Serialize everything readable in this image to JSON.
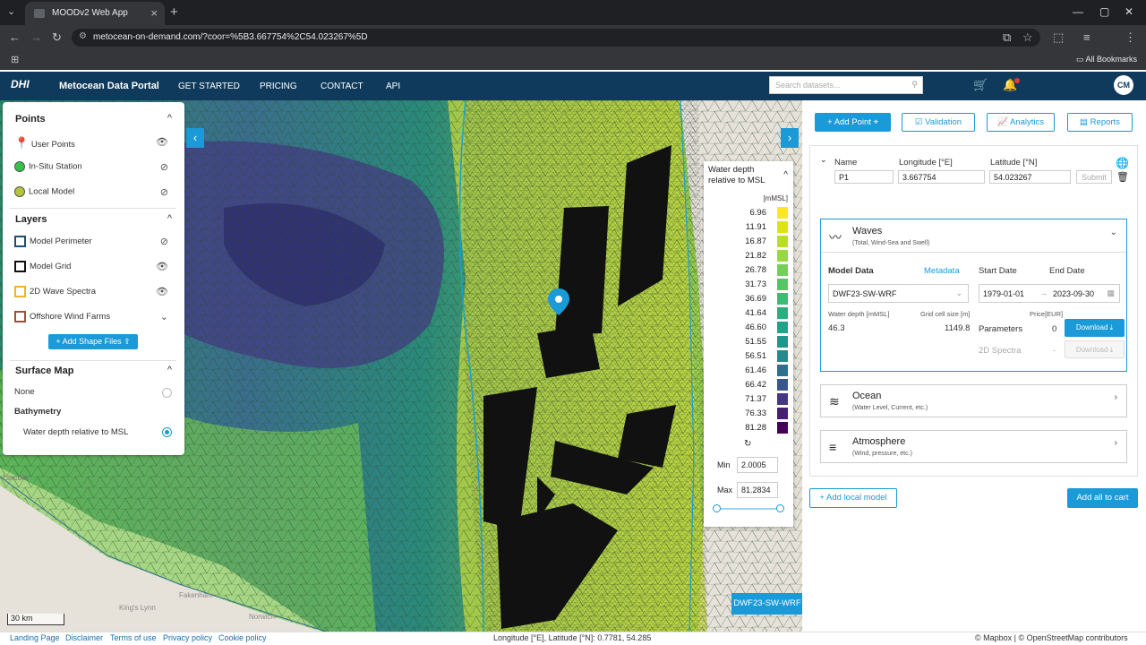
{
  "browser": {
    "tab_title": "MOODv2 Web App",
    "url": "metocean-on-demand.com/?coor=%5B3.667754%2C54.023267%5D",
    "all_bookmarks": "All Bookmarks"
  },
  "header": {
    "logo": "DHI",
    "portal_title": "Metocean Data Portal",
    "nav": [
      "GET STARTED",
      "PRICING",
      "CONTACT",
      "API"
    ],
    "search_placeholder": "Search datasets...",
    "avatar": "CM"
  },
  "left_panel": {
    "points": {
      "title": "Points",
      "items": [
        {
          "label": "User Points",
          "visible": true
        },
        {
          "label": "In-Situ Station",
          "visible": false
        },
        {
          "label": "Local Model",
          "visible": false
        }
      ]
    },
    "layers": {
      "title": "Layers",
      "items": [
        {
          "label": "Model Perimeter",
          "visible": false,
          "color": "#1f4e6e"
        },
        {
          "label": "Model Grid",
          "visible": true,
          "color": "#111111"
        },
        {
          "label": "2D Wave Spectra",
          "visible": true,
          "color": "#f0b429"
        },
        {
          "label": "Offshore Wind Farms",
          "color": "#a0522d"
        }
      ],
      "add_shape": "+ Add Shape Files"
    },
    "surface_map": {
      "title": "Surface Map",
      "none": "None",
      "group": "Bathymetry",
      "option": "Water depth relative to MSL"
    }
  },
  "legend": {
    "title_line1": "Water depth",
    "title_line2": "relative to MSL",
    "unit": "[mMSL]",
    "entries": [
      {
        "value": "6.96",
        "color": "#fde725"
      },
      {
        "value": "11.91",
        "color": "#dde318"
      },
      {
        "value": "16.87",
        "color": "#b8de29"
      },
      {
        "value": "21.82",
        "color": "#95d840"
      },
      {
        "value": "26.78",
        "color": "#73d055"
      },
      {
        "value": "31.73",
        "color": "#55c667"
      },
      {
        "value": "36.69",
        "color": "#3cbb75"
      },
      {
        "value": "41.64",
        "color": "#29af7f"
      },
      {
        "value": "46.60",
        "color": "#20a386"
      },
      {
        "value": "51.55",
        "color": "#1f968b"
      },
      {
        "value": "56.51",
        "color": "#238a8d"
      },
      {
        "value": "61.46",
        "color": "#2d708e"
      },
      {
        "value": "66.42",
        "color": "#39568c"
      },
      {
        "value": "71.37",
        "color": "#453781"
      },
      {
        "value": "76.33",
        "color": "#481f70"
      },
      {
        "value": "81.28",
        "color": "#440154"
      }
    ],
    "min_label": "Min",
    "min_value": "2.0005",
    "max_label": "Max",
    "max_value": "81.2834"
  },
  "map": {
    "places": [
      "Lincoln",
      "Fakenham",
      "King's Lynn",
      "Norwich"
    ],
    "scale": "30 km",
    "model_tag": "DWF23-SW-WRF"
  },
  "footer": {
    "links": [
      "Landing Page",
      "Disclaimer",
      "Terms of use",
      "Privacy policy",
      "Cookie policy"
    ],
    "coords": "Longitude [°E], Latitude [°N]: 0.7781, 54.285",
    "attribution": "© Mapbox | © OpenStreetMap contributors"
  },
  "right_panel": {
    "buttons": [
      "+ Add Point",
      "Validation",
      "Analytics",
      "Reports"
    ],
    "point": {
      "name_label": "Name",
      "lon_label": "Longitude [°E]",
      "lat_label": "Latitude [°N]",
      "name": "P1",
      "lon": "3.667754",
      "lat": "54.023267",
      "submit": "Submit"
    },
    "waves": {
      "title": "Waves",
      "subtitle": "(Total, Wind-Sea and Swell)",
      "model_data": "Model Data",
      "metadata": "Metadata",
      "start_label": "Start Date",
      "end_label": "End Date",
      "model": "DWF23-SW-WRF",
      "start": "1979-01-01",
      "end": "2023-09-30",
      "depth_label": "Water depth [mMSL]",
      "grid_label": "Grid cell size [m]",
      "price_label": "Price[EUR]",
      "depth": "46.3",
      "grid": "1149.8",
      "parameters": "Parameters",
      "params_price": "0",
      "spectra": "2D Spectra",
      "spectra_price": "-",
      "download": "Download"
    },
    "ocean": {
      "title": "Ocean",
      "subtitle": "(Water Level, Current, etc.)"
    },
    "atmosphere": {
      "title": "Atmosphere",
      "subtitle": "(Wind, pressure, etc.)"
    },
    "add_local": "+ Add local model",
    "add_cart": "Add all to cart"
  }
}
